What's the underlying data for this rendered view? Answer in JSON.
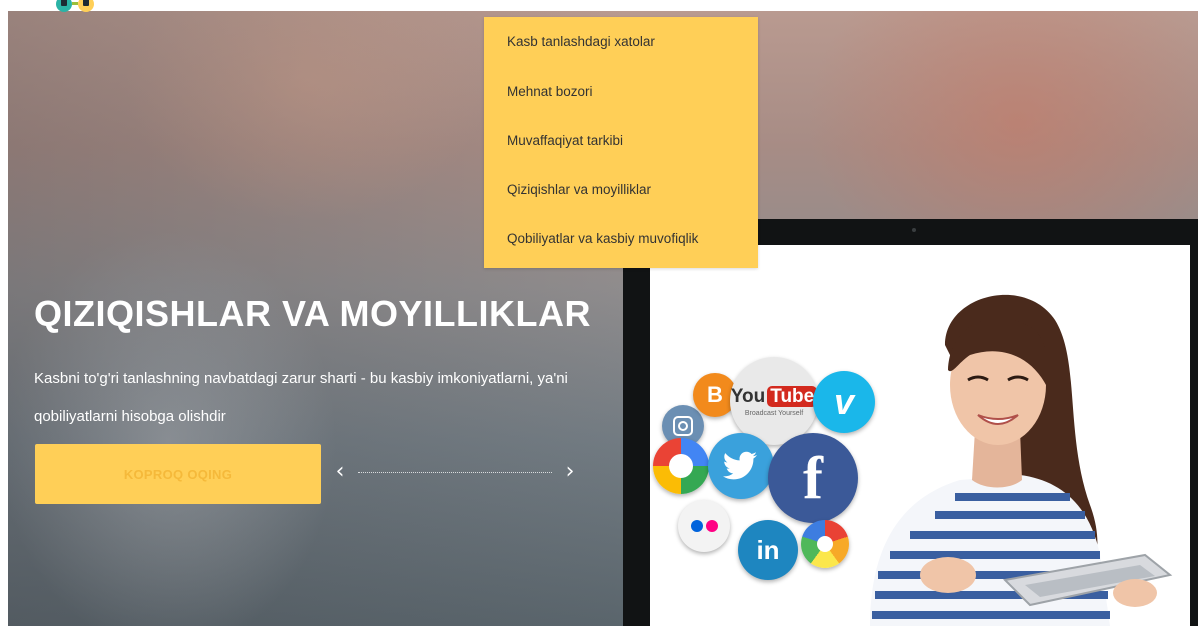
{
  "menu": {
    "items": [
      {
        "label": "Kasb tanlashdagi xatolar"
      },
      {
        "label": "Mehnat bozori"
      },
      {
        "label": "Muvaffaqiyat tarkibi"
      },
      {
        "label": "Qiziqishlar va moyilliklar"
      },
      {
        "label": "Qobiliyatlar va kasbiy muvofiqlik"
      }
    ]
  },
  "hero": {
    "title": "QIZIQISHLAR VA MOYILLIKLAR",
    "description": "Kasbni to'g'ri tanlashning navbatdagi zarur sharti - bu kasbiy imkoniyatlarni, ya'ni qobiliyatlarni hisobga olishdir",
    "cta_label": "KOPROQ OQING"
  },
  "slider": {
    "prev_glyph": "‹",
    "next_glyph": "›"
  },
  "image": {
    "youtube_text_1": "You",
    "youtube_text_2": "Tube",
    "youtube_tagline": "Broadcast Yourself",
    "facebook_glyph": "f",
    "linkedin_glyph": "in",
    "vimeo_glyph": "v",
    "blogger_glyph": "B"
  },
  "colors": {
    "accent": "#ffcf57",
    "cta_text": "#f5b93a",
    "menu_text": "#333333"
  },
  "icons": [
    "logo-icon",
    "chevron-left-icon",
    "chevron-right-icon",
    "youtube-icon",
    "facebook-icon",
    "twitter-icon",
    "linkedin-icon",
    "vimeo-icon",
    "blogger-icon",
    "google-icon",
    "instagram-icon",
    "flickr-icon",
    "picasa-icon"
  ]
}
